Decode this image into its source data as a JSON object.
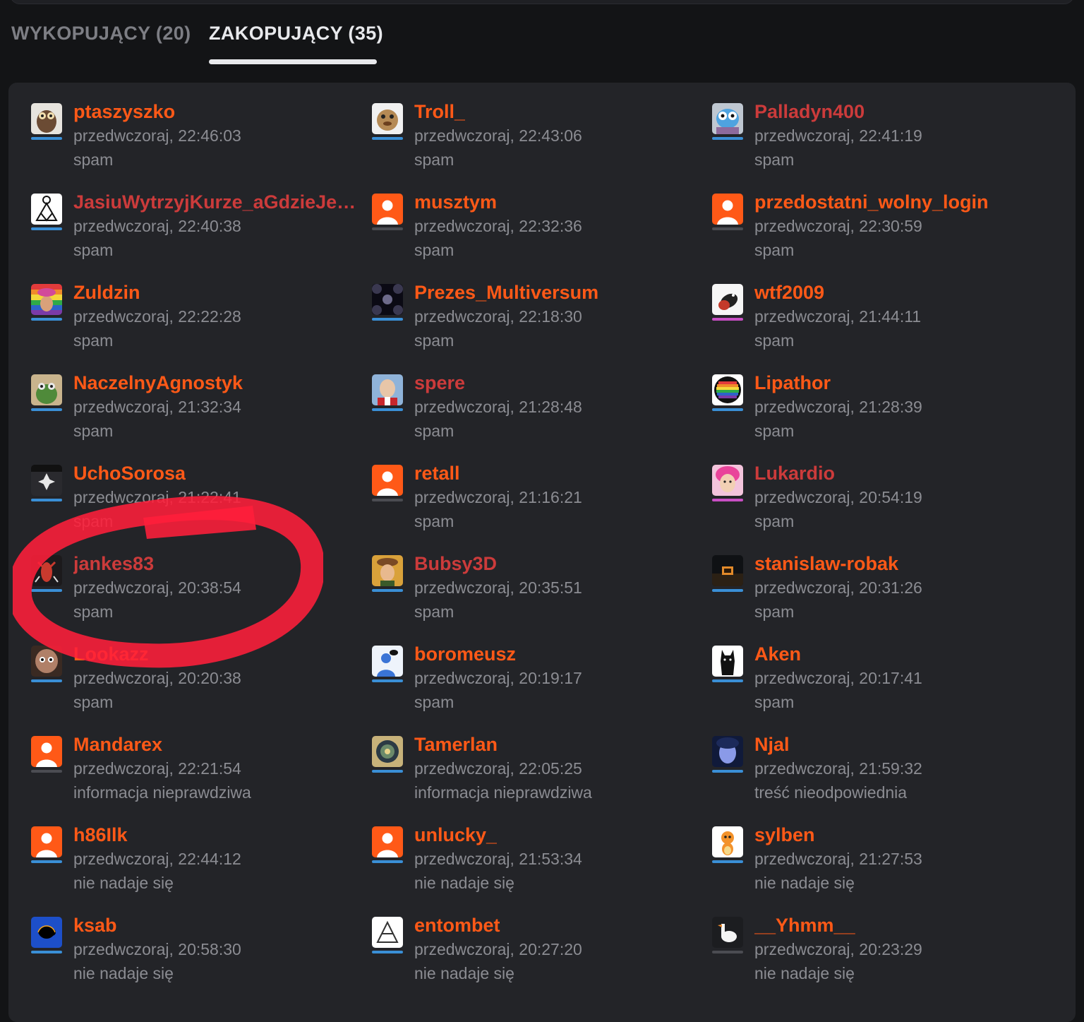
{
  "tabs": {
    "upvoters": "WYKOPUJĄCY (20)",
    "downvoters": "ZAKOPUJĄCY (35)"
  },
  "colors": {
    "orange": "#ff5917",
    "red": "#cc3b3b",
    "bar_blue": "#3a8fd6",
    "bar_pink": "#c84fc4",
    "bar_gray": "#4b4c52",
    "marker": "#ff1f3a"
  },
  "voters": [
    {
      "name": "ptaszyszko",
      "time": "przedwczoraj, 22:46:03",
      "reason": "spam",
      "color": "orange",
      "bar": "blue",
      "avatar": "owl-avatar"
    },
    {
      "name": "Troll_",
      "time": "przedwczoraj, 22:43:06",
      "reason": "spam",
      "color": "orange",
      "bar": "blue",
      "avatar": "puppet-avatar"
    },
    {
      "name": "Palladyn400",
      "time": "przedwczoraj, 22:41:19",
      "reason": "spam",
      "color": "red",
      "bar": "blue",
      "avatar": "cartoon-cat-avatar"
    },
    {
      "name": "JasiuWytrzyjKurze_aGdzieJestT...",
      "time": "przedwczoraj, 22:40:38",
      "reason": "spam",
      "color": "red",
      "bar": "blue",
      "avatar": "stargate-symbol-avatar"
    },
    {
      "name": "musztym",
      "time": "przedwczoraj, 22:32:36",
      "reason": "spam",
      "color": "orange",
      "bar": "gray",
      "avatar": "default-avatar"
    },
    {
      "name": "przedostatni_wolny_login",
      "time": "przedwczoraj, 22:30:59",
      "reason": "spam",
      "color": "orange",
      "bar": "gray",
      "avatar": "default-avatar"
    },
    {
      "name": "Zuldzin",
      "time": "przedwczoraj, 22:22:28",
      "reason": "spam",
      "color": "orange",
      "bar": "blue",
      "avatar": "rainbow-avatar"
    },
    {
      "name": "Prezes_Multiversum",
      "time": "przedwczoraj, 22:18:30",
      "reason": "spam",
      "color": "orange",
      "bar": "blue",
      "avatar": "spheres-avatar"
    },
    {
      "name": "wtf2009",
      "time": "przedwczoraj, 21:44:11",
      "reason": "spam",
      "color": "orange",
      "bar": "pink",
      "avatar": "bird-avatar"
    },
    {
      "name": "NaczelnyAgnostyk",
      "time": "przedwczoraj, 21:32:34",
      "reason": "spam",
      "color": "orange",
      "bar": "blue",
      "avatar": "frog-avatar"
    },
    {
      "name": "spere",
      "time": "przedwczoraj, 21:28:48",
      "reason": "spam",
      "color": "red",
      "bar": "blue",
      "avatar": "photo-avatar"
    },
    {
      "name": "Lipathor",
      "time": "przedwczoraj, 21:28:39",
      "reason": "spam",
      "color": "orange",
      "bar": "blue",
      "avatar": "rainbow-circle-avatar"
    },
    {
      "name": "UchoSorosa",
      "time": "przedwczoraj, 21:22:41",
      "reason": "spam",
      "color": "orange",
      "bar": "blue",
      "avatar": "cross-avatar"
    },
    {
      "name": "retall",
      "time": "przedwczoraj, 21:16:21",
      "reason": "spam",
      "color": "orange",
      "bar": "gray",
      "avatar": "default-avatar"
    },
    {
      "name": "Lukardio",
      "time": "przedwczoraj, 20:54:19",
      "reason": "spam",
      "color": "red",
      "bar": "pink",
      "avatar": "pink-hair-avatar"
    },
    {
      "name": "jankes83",
      "time": "przedwczoraj, 20:38:54",
      "reason": "spam",
      "color": "red",
      "bar": "blue",
      "avatar": "lobster-avatar"
    },
    {
      "name": "Bubsy3D",
      "time": "przedwczoraj, 20:35:51",
      "reason": "spam",
      "color": "red",
      "bar": "blue",
      "avatar": "painting-avatar"
    },
    {
      "name": "stanislaw-robak",
      "time": "przedwczoraj, 20:31:26",
      "reason": "spam",
      "color": "orange",
      "bar": "blue",
      "avatar": "dark-scene-avatar"
    },
    {
      "name": "Lookazz",
      "time": "przedwczoraj, 20:20:38",
      "reason": "spam",
      "color": "orange",
      "bar": "blue",
      "avatar": "face-avatar"
    },
    {
      "name": "boromeusz",
      "time": "przedwczoraj, 20:19:17",
      "reason": "spam",
      "color": "orange",
      "bar": "blue",
      "avatar": "person-fly-avatar"
    },
    {
      "name": "Aken",
      "time": "przedwczoraj, 20:17:41",
      "reason": "spam",
      "color": "orange",
      "bar": "blue",
      "avatar": "black-cat-avatar"
    },
    {
      "name": "Mandarex",
      "time": "przedwczoraj, 22:21:54",
      "reason": "informacja nieprawdziwa",
      "color": "orange",
      "bar": "gray",
      "avatar": "default-avatar"
    },
    {
      "name": "Tamerlan",
      "time": "przedwczoraj, 22:05:25",
      "reason": "informacja nieprawdziwa",
      "color": "orange",
      "bar": "blue",
      "avatar": "ornament-avatar"
    },
    {
      "name": "Njal",
      "time": "przedwczoraj, 21:59:32",
      "reason": "treść nieodpowiednia",
      "color": "orange",
      "bar": "blue",
      "avatar": "blue-face-avatar"
    },
    {
      "name": "h86Ilk",
      "time": "przedwczoraj, 22:44:12",
      "reason": "nie nadaje się",
      "color": "orange",
      "bar": "blue",
      "avatar": "default-avatar"
    },
    {
      "name": "unlucky_",
      "time": "przedwczoraj, 21:53:34",
      "reason": "nie nadaje się",
      "color": "orange",
      "bar": "blue",
      "avatar": "default-avatar"
    },
    {
      "name": "sylben",
      "time": "przedwczoraj, 21:27:53",
      "reason": "nie nadaje się",
      "color": "orange",
      "bar": "blue",
      "avatar": "charmander-avatar"
    },
    {
      "name": "ksab",
      "time": "przedwczoraj, 20:58:30",
      "reason": "nie nadaje się",
      "color": "orange",
      "bar": "blue",
      "avatar": "fractal-avatar"
    },
    {
      "name": "entombet",
      "time": "przedwczoraj, 20:27:20",
      "reason": "nie nadaje się",
      "color": "orange",
      "bar": "blue",
      "avatar": "sketch-avatar"
    },
    {
      "name": "__Yhmm__",
      "time": "przedwczoraj, 20:23:29",
      "reason": "nie nadaje się",
      "color": "orange",
      "bar": "gray",
      "avatar": "goose-avatar"
    }
  ]
}
